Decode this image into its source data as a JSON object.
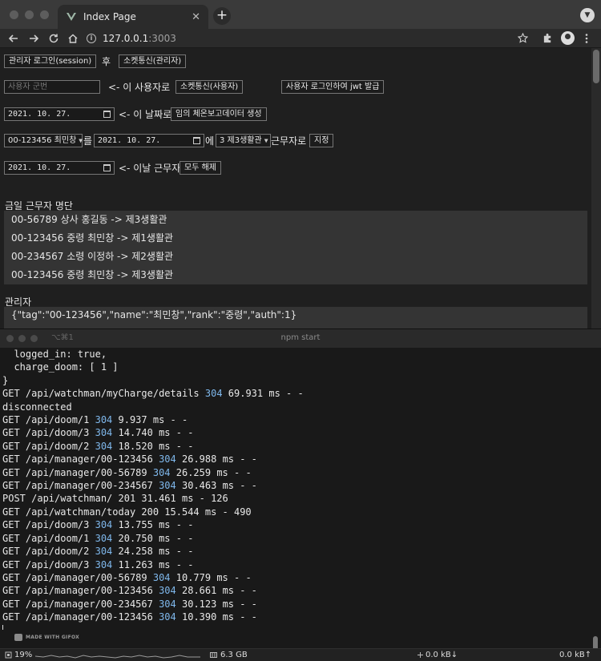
{
  "browser": {
    "tab_title": "Index Page",
    "close_glyph": "✕",
    "new_tab_glyph": "+",
    "url_host": "127.0.0.1",
    "url_port": ":3003",
    "menu_glyph": "▼"
  },
  "form": {
    "admin_login": "관리자 로그인(session)",
    "after": "후",
    "socket_admin": "소켓통신(관리자)",
    "user_id_placeholder": "사용자 군번",
    "as_user_label": "<- 이 사용자로",
    "socket_user": "소켓통신(사용자)",
    "jwt_button": "사용자 로그인하여 jwt 발급",
    "date1": "2021. 10. 27.",
    "date_label": "<- 이 날짜로",
    "generate_button": "임의 체온보고데이터 생성",
    "select_person": "00-123456 최민창",
    "reul": "를",
    "date2": "2021. 10. 27.",
    "e": "에",
    "select_doom": "3 제3생활관",
    "duty_label": "근무자로",
    "assign_button": "지정",
    "date3": "2021. 10. 27.",
    "day_duty_label": "<- 이날 근무자",
    "clear_button": "모두 해제"
  },
  "today_section": {
    "title": "금일 근무자 명단",
    "rows": [
      "00-56789 상사 홍길동 -> 제3생활관",
      "00-123456 중령 최민창 -> 제1생활관",
      "00-234567 소령 이정하 -> 제2생활관",
      "00-123456 중령 최민창 -> 제3생활관"
    ]
  },
  "admin_section": {
    "title": "관리자",
    "row": "{\"tag\":\"00-123456\",\"name\":\"최민창\",\"rank\":\"중령\",\"auth\":1}"
  },
  "terminal": {
    "shortcut": "⌥⌘1",
    "title": "npm start",
    "lines": [
      [
        "  logged_in: true,"
      ],
      [
        "  charge_doom: [ 1 ]"
      ],
      [
        "}"
      ],
      [
        "GET /api/watchman/myCharge/details ",
        "304",
        " 69.931 ms - -"
      ],
      [
        "disconnected"
      ],
      [
        "GET /api/doom/1 ",
        "304",
        " 9.937 ms - -"
      ],
      [
        "GET /api/doom/3 ",
        "304",
        " 14.740 ms - -"
      ],
      [
        "GET /api/doom/2 ",
        "304",
        " 18.520 ms - -"
      ],
      [
        "GET /api/manager/00-123456 ",
        "304",
        " 26.988 ms - -"
      ],
      [
        "GET /api/manager/00-56789 ",
        "304",
        " 26.259 ms - -"
      ],
      [
        "GET /api/manager/00-234567 ",
        "304",
        " 30.463 ms - -"
      ],
      [
        "POST /api/watchman/ 201 31.461 ms - 126"
      ],
      [
        "GET /api/watchman/today 200 15.544 ms - 490"
      ],
      [
        "GET /api/doom/3 ",
        "304",
        " 13.755 ms - -"
      ],
      [
        "GET /api/doom/1 ",
        "304",
        " 20.750 ms - -"
      ],
      [
        "GET /api/doom/2 ",
        "304",
        " 24.258 ms - -"
      ],
      [
        "GET /api/doom/3 ",
        "304",
        " 11.263 ms - -"
      ],
      [
        "GET /api/manager/00-56789 ",
        "304",
        " 10.779 ms - -"
      ],
      [
        "GET /api/manager/00-123456 ",
        "304",
        " 28.661 ms - -"
      ],
      [
        "GET /api/manager/00-234567 ",
        "304",
        " 30.123 ms - -"
      ],
      [
        "GET /api/manager/00-123456 ",
        "304",
        " 10.390 ms - -"
      ]
    ],
    "watermark": "MADE WITH GIFOX"
  },
  "status": {
    "cpu": "19%",
    "memory": "6.3 GB",
    "net_down": "0.0 kB↓",
    "net_up": "0.0 kB↑"
  },
  "colors": {
    "status_code_304": "#7fb8ec",
    "page_bg": "#1f1f1f",
    "list_bg": "#343434"
  }
}
